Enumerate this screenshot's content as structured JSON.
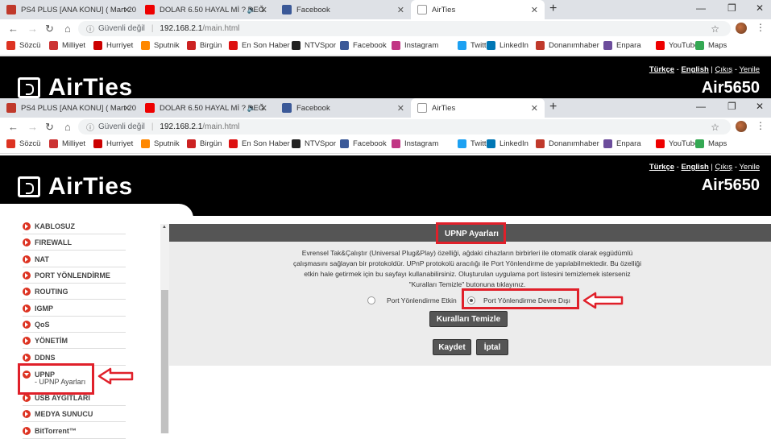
{
  "tabs": [
    {
      "title": "PS4 PLUS [ANA KONU] ( Mart 20",
      "favicon_color": "#c0392b",
      "favicon_text": "DH"
    },
    {
      "title": "DOLAR 6.50 HAYAL Mİ ? DEĞ",
      "favicon_color": "#e00",
      "favicon_text": "▶"
    },
    {
      "title": "Facebook",
      "favicon_color": "#3b5998",
      "favicon_text": "f"
    },
    {
      "title": "AirTies",
      "favicon_color": "#ccc",
      "favicon_text": ""
    }
  ],
  "window_controls": {
    "minimize": "—",
    "maximize": "❐",
    "close": "✕"
  },
  "address_bar": {
    "insecure_label": "Güvenli değil",
    "url_host": "192.168.2.1",
    "url_path": "/main.html"
  },
  "bookmarks": [
    {
      "label": "Sözcü",
      "color": "#d32"
    },
    {
      "label": "Milliyet",
      "color": "#c33"
    },
    {
      "label": "Hurriyet",
      "color": "#c00"
    },
    {
      "label": "Sputnik",
      "color": "#f80"
    },
    {
      "label": "Birgün",
      "color": "#c22"
    },
    {
      "label": "En Son Haber",
      "color": "#d11"
    },
    {
      "label": "NTVSpor",
      "color": "#222"
    },
    {
      "label": "Facebook",
      "color": "#3b5998"
    },
    {
      "label": "Instagram",
      "color": "#c13584"
    },
    {
      "label": "Twitter",
      "color": "#1da1f2"
    },
    {
      "label": "LinkedIn",
      "color": "#0077b5"
    },
    {
      "label": "Donanımhaber",
      "color": "#c0392b"
    },
    {
      "label": "Enpara",
      "color": "#6c4d9c"
    },
    {
      "label": "YouTube",
      "color": "#e00"
    },
    {
      "label": "Maps",
      "color": "#34a853"
    }
  ],
  "header": {
    "brand": "AirTies",
    "model": "Air5650",
    "lang_tr": "Türkçe",
    "lang_en": "English",
    "logout": "Çıkış",
    "refresh": "Yenile",
    "separator": "-"
  },
  "sidebar": {
    "items": [
      "KABLOSUZ",
      "FIREWALL",
      "NAT",
      "PORT YÖNLENDİRME",
      "ROUTING",
      "IGMP",
      "QoS",
      "YÖNETİM",
      "DDNS",
      "UPNP",
      "USB AYGITLARI",
      "MEDYA SUNUCU",
      "BitTorrent™"
    ],
    "active_item": "UPNP",
    "sub_item": "- UPNP Ayarları"
  },
  "main": {
    "title": "UPNP Ayarları",
    "description_lines": [
      "Evrensel Tak&Çalıştır (Universal Plug&Play) özelliği, ağdaki cihazların birbirleri ile otomatik olarak eşgüdümlü",
      "çalışmasını sağlayan bir protokoldür. UPnP protokolü aracılığı ile Port Yönlendirme de yapılabilmektedir. Bu özelliği",
      "etkin hale getirmek için bu sayfayı kullanabilirsiniz. Oluşturulan uygulama port listesini temizlemek isterseniz",
      "\"Kuralları Temizle\" butonuna tıklayınız."
    ],
    "radio_enabled": "Port Yönlendirme Etkin",
    "radio_disabled": "Port Yönlendirme Devre Dışı",
    "selected_option": "Port Yönlendirme Devre Dışı",
    "clear_rules_button": "Kuralları Temizle",
    "save_button": "Kaydet",
    "cancel_button": "İptal"
  },
  "colors": {
    "highlight": "#e0202a",
    "header_bg": "#000000",
    "accent_red": "#d32f2f"
  }
}
